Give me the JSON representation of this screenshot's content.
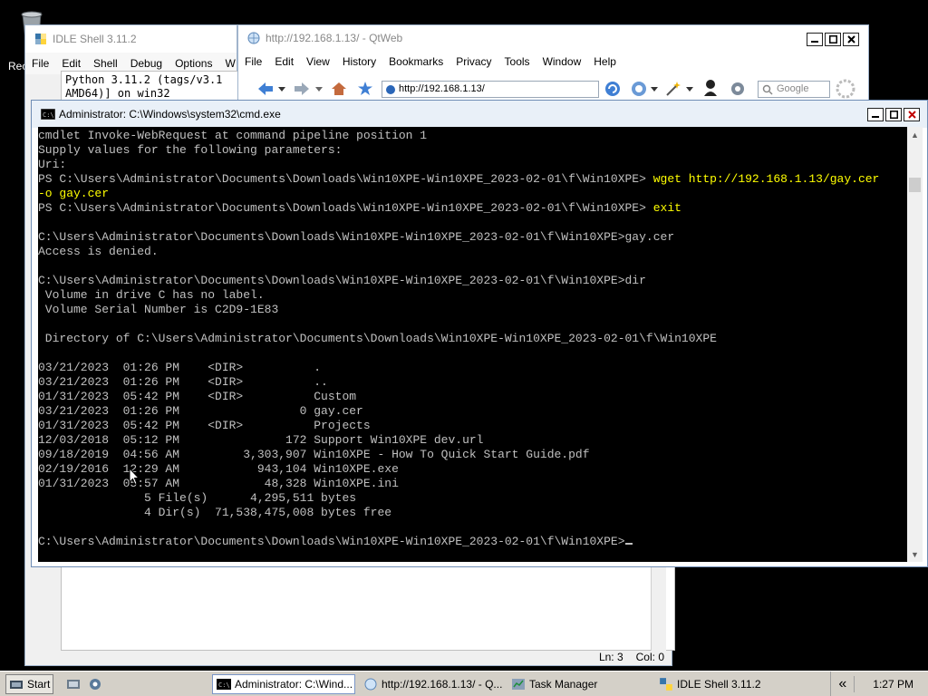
{
  "desktop": {
    "icon_label": "Rec"
  },
  "idle": {
    "title": "IDLE Shell 3.11.2",
    "menu": [
      "File",
      "Edit",
      "Shell",
      "Debug",
      "Options",
      "W"
    ],
    "lines": [
      "Python 3.11.2 (tags/v3.1",
      "AMD64)] on win32"
    ],
    "status_ln": "Ln: 3",
    "status_col": "Col: 0"
  },
  "qtweb": {
    "title": "http://192.168.1.13/ - QtWeb",
    "menu": [
      "File",
      "Edit",
      "View",
      "History",
      "Bookmarks",
      "Privacy",
      "Tools",
      "Window",
      "Help"
    ],
    "url": "http://192.168.1.13/",
    "search_placeholder": "Google"
  },
  "cmd": {
    "title": "Administrator: C:\\Windows\\system32\\cmd.exe",
    "lines": [
      {
        "text": "cmdlet Invoke-WebRequest at command pipeline position 1",
        "cmd": ""
      },
      {
        "text": "Supply values for the following parameters:",
        "cmd": ""
      },
      {
        "text": "Uri:",
        "cmd": ""
      },
      {
        "text": "PS C:\\Users\\Administrator\\Documents\\Downloads\\Win10XPE-Win10XPE_2023-02-01\\f\\Win10XPE> ",
        "cmd": "wget http://192.168.1.13/gay.cer"
      },
      {
        "text": "",
        "cmd": "-o gay.cer"
      },
      {
        "text": "PS C:\\Users\\Administrator\\Documents\\Downloads\\Win10XPE-Win10XPE_2023-02-01\\f\\Win10XPE> ",
        "cmd": "exit"
      },
      {
        "text": "",
        "cmd": ""
      },
      {
        "text": "C:\\Users\\Administrator\\Documents\\Downloads\\Win10XPE-Win10XPE_2023-02-01\\f\\Win10XPE>gay.cer",
        "cmd": ""
      },
      {
        "text": "Access is denied.",
        "cmd": ""
      },
      {
        "text": "",
        "cmd": ""
      },
      {
        "text": "C:\\Users\\Administrator\\Documents\\Downloads\\Win10XPE-Win10XPE_2023-02-01\\f\\Win10XPE>dir",
        "cmd": ""
      },
      {
        "text": " Volume in drive C has no label.",
        "cmd": ""
      },
      {
        "text": " Volume Serial Number is C2D9-1E83",
        "cmd": ""
      },
      {
        "text": "",
        "cmd": ""
      },
      {
        "text": " Directory of C:\\Users\\Administrator\\Documents\\Downloads\\Win10XPE-Win10XPE_2023-02-01\\f\\Win10XPE",
        "cmd": ""
      },
      {
        "text": "",
        "cmd": ""
      },
      {
        "text": "03/21/2023  01:26 PM    <DIR>          .",
        "cmd": ""
      },
      {
        "text": "03/21/2023  01:26 PM    <DIR>          ..",
        "cmd": ""
      },
      {
        "text": "01/31/2023  05:42 PM    <DIR>          Custom",
        "cmd": ""
      },
      {
        "text": "03/21/2023  01:26 PM                 0 gay.cer",
        "cmd": ""
      },
      {
        "text": "01/31/2023  05:42 PM    <DIR>          Projects",
        "cmd": ""
      },
      {
        "text": "12/03/2018  05:12 PM               172 Support Win10XPE dev.url",
        "cmd": ""
      },
      {
        "text": "09/18/2019  04:56 AM         3,303,907 Win10XPE - How To Quick Start Guide.pdf",
        "cmd": ""
      },
      {
        "text": "02/19/2016  12:29 AM           943,104 Win10XPE.exe",
        "cmd": ""
      },
      {
        "text": "01/31/2023  05:57 AM            48,328 Win10XPE.ini",
        "cmd": ""
      },
      {
        "text": "               5 File(s)      4,295,511 bytes",
        "cmd": ""
      },
      {
        "text": "               4 Dir(s)  71,538,475,008 bytes free",
        "cmd": ""
      },
      {
        "text": "",
        "cmd": ""
      },
      {
        "text": "C:\\Users\\Administrator\\Documents\\Downloads\\Win10XPE-Win10XPE_2023-02-01\\f\\Win10XPE>",
        "cmd": ""
      }
    ]
  },
  "taskbar": {
    "start_label": "Start",
    "items": [
      {
        "label": "Administrator: C:\\Wind..."
      },
      {
        "label": "http://192.168.1.13/ - Q..."
      },
      {
        "label": "Task Manager"
      },
      {
        "label": "IDLE Shell 3.11.2"
      }
    ],
    "tray_toggle": "«",
    "clock": "1:27 PM"
  }
}
